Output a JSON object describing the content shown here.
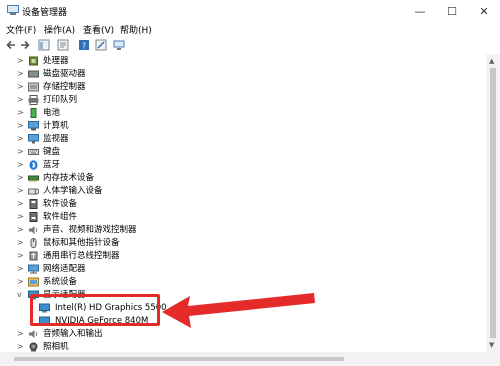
{
  "window": {
    "title": "设备管理器",
    "minimize_icon": "—",
    "maximize_icon": "☐",
    "close_icon": "✕"
  },
  "menu": [
    "文件(F)",
    "操作(A)",
    "查看(V)",
    "帮助(H)"
  ],
  "tree": [
    {
      "label": "处理器",
      "icon": "cpu-icon",
      "expanded": false
    },
    {
      "label": "磁盘驱动器",
      "icon": "disk-icon",
      "expanded": false
    },
    {
      "label": "存储控制器",
      "icon": "storage-icon",
      "expanded": false
    },
    {
      "label": "打印队列",
      "icon": "printer-icon",
      "expanded": false
    },
    {
      "label": "电池",
      "icon": "battery-icon",
      "expanded": false
    },
    {
      "label": "计算机",
      "icon": "computer-icon",
      "expanded": false
    },
    {
      "label": "监视器",
      "icon": "monitor-icon",
      "expanded": false
    },
    {
      "label": "键盘",
      "icon": "keyboard-icon",
      "expanded": false
    },
    {
      "label": "蓝牙",
      "icon": "bluetooth-icon",
      "expanded": false
    },
    {
      "label": "内存技术设备",
      "icon": "memory-icon",
      "expanded": false
    },
    {
      "label": "人体学输入设备",
      "icon": "hid-icon",
      "expanded": false
    },
    {
      "label": "软件设备",
      "icon": "software-device-icon",
      "expanded": false
    },
    {
      "label": "软件组件",
      "icon": "software-component-icon",
      "expanded": false
    },
    {
      "label": "声音、视频和游戏控制器",
      "icon": "sound-icon",
      "expanded": false
    },
    {
      "label": "鼠标和其他指针设备",
      "icon": "mouse-icon",
      "expanded": false
    },
    {
      "label": "通用串行总线控制器",
      "icon": "usb-icon",
      "expanded": false
    },
    {
      "label": "网络适配器",
      "icon": "network-icon",
      "expanded": false
    },
    {
      "label": "系统设备",
      "icon": "system-icon",
      "expanded": false
    },
    {
      "label": "显示适配器",
      "icon": "display-adapter-icon",
      "expanded": true
    },
    {
      "label": "Intel(R) HD Graphics 5500",
      "icon": "display-adapter-icon",
      "child": true
    },
    {
      "label": "NVIDIA GeForce 840M",
      "icon": "display-adapter-icon",
      "child": true
    },
    {
      "label": "音频输入和输出",
      "icon": "audio-io-icon",
      "expanded": false
    },
    {
      "label": "照相机",
      "icon": "camera-icon",
      "expanded": false
    }
  ],
  "colors": {
    "highlight_border": "#e52a2a",
    "accent": "#1e78d2"
  }
}
